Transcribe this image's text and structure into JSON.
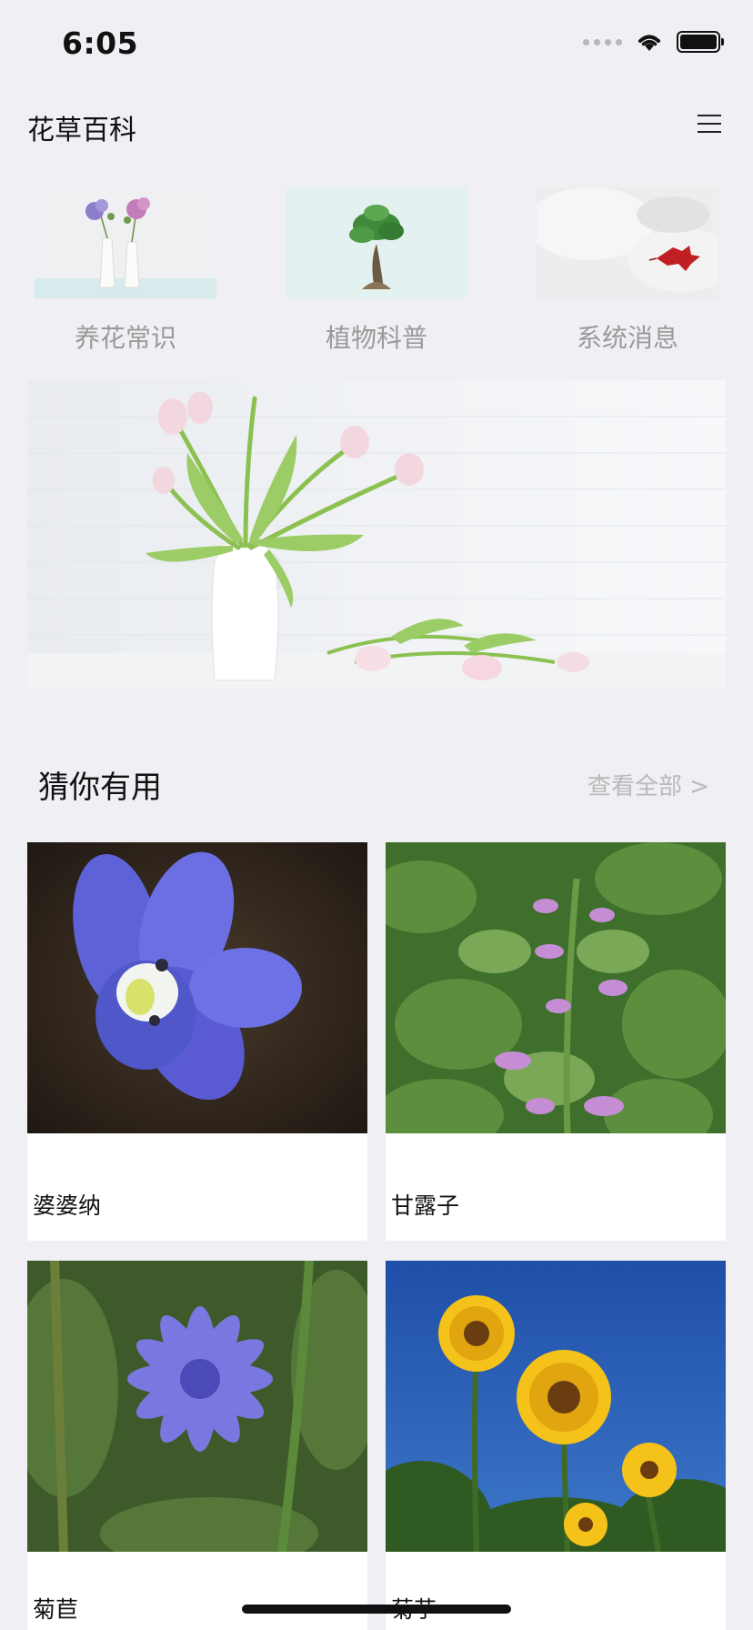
{
  "status_bar": {
    "time": "6:05",
    "icons": [
      "signal-dots-icon",
      "wifi-icon",
      "battery-icon"
    ]
  },
  "header": {
    "title": "花草百科",
    "menu_icon": "hamburger-menu-icon"
  },
  "categories": [
    {
      "label": "养花常识",
      "image": "vases-with-hydrangea"
    },
    {
      "label": "植物科普",
      "image": "bonsai-tree"
    },
    {
      "label": "系统消息",
      "image": "red-leaf-on-snow"
    }
  ],
  "banner": {
    "image": "tulips-in-white-vase"
  },
  "section": {
    "title": "猜你有用",
    "view_all": "查看全部 >"
  },
  "plants": [
    {
      "name": "婆婆纳",
      "image": "blue-speedwell-flower"
    },
    {
      "name": "甘露子",
      "image": "purple-chinese-artichoke-flower"
    },
    {
      "name": "菊苣",
      "image": "blue-chicory-flower"
    },
    {
      "name": "菊芋",
      "image": "yellow-jerusalem-artichoke-flower"
    }
  ],
  "colors": {
    "background": "#efeff4",
    "muted_text": "#9a9a9a",
    "card": "#ffffff"
  }
}
